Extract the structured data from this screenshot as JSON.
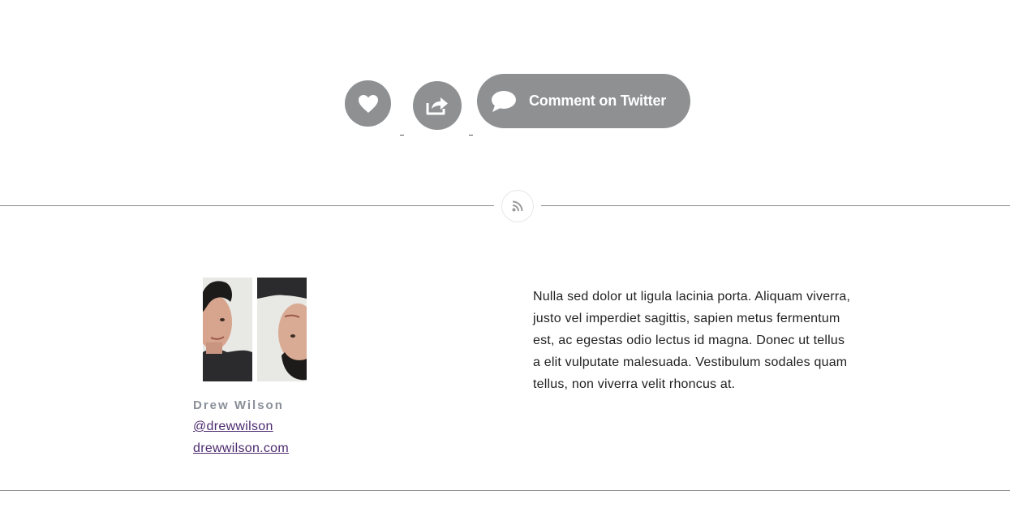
{
  "actions": {
    "like_icon": "heart-icon",
    "share_icon": "share-arrow-icon",
    "comment_icon": "speech-bubble-icon",
    "comment_label": "Comment on Twitter",
    "button_color": "#8e9092"
  },
  "divider": {
    "icon": "rss-icon"
  },
  "author": {
    "name": "Drew Wilson",
    "handle": "@drewwilson",
    "website": "drewwilson.com",
    "link_color": "#4c2a6e"
  },
  "bio": {
    "text": "Nulla sed dolor ut ligula lacinia porta. Aliquam viverra, justo vel imperdiet sagittis, sapien metus fermentum est, ac egestas odio lectus id magna. Donec ut tellus a elit vulputate malesuada. Vestibulum sodales quam tellus, non viverra velit rhoncus at."
  }
}
